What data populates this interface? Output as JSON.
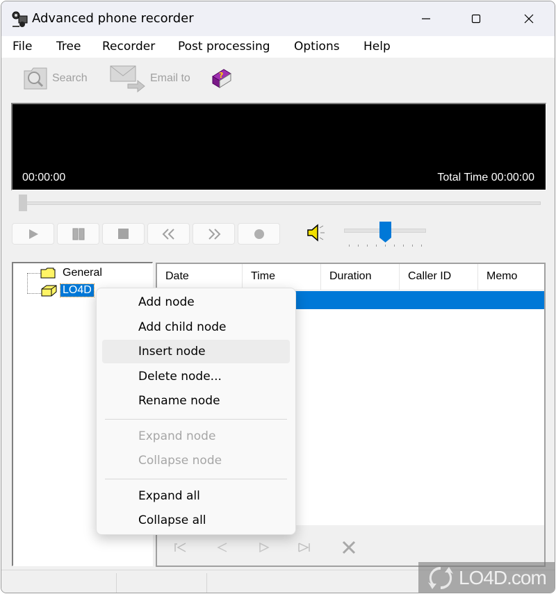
{
  "window": {
    "title": "Advanced phone recorder",
    "controls": {
      "minimize": "minimize",
      "maximize": "maximize",
      "close": "close"
    }
  },
  "menubar": {
    "items": [
      {
        "label": "File"
      },
      {
        "label": "Tree"
      },
      {
        "label": "Recorder"
      },
      {
        "label": "Post processing"
      },
      {
        "label": "Options"
      },
      {
        "label": "Help"
      }
    ]
  },
  "toolbar": {
    "search_label": "Search",
    "email_label": "Email to",
    "help_icon": "help-book-icon"
  },
  "display": {
    "current_time": "00:00:00",
    "total_time": "Total Time 00:00:00"
  },
  "player": {
    "seek_position": 0,
    "controls": [
      "play",
      "pause",
      "stop",
      "rewind",
      "fast-forward",
      "record"
    ],
    "volume_percent": 50,
    "volume_ticks": 9
  },
  "tree": {
    "nodes": [
      {
        "label": "General",
        "icon": "folder-closed-icon",
        "selected": false
      },
      {
        "label": "LO4D",
        "icon": "folder-open-icon",
        "selected": true
      }
    ]
  },
  "list": {
    "columns": [
      "Date",
      "Time",
      "Duration",
      "Caller ID",
      "Memo"
    ],
    "selected_row": 0,
    "nav_buttons": [
      "first",
      "previous",
      "next",
      "last",
      "delete"
    ]
  },
  "context_menu": {
    "items": [
      {
        "label": "Add node",
        "disabled": false
      },
      {
        "label": "Add child node",
        "disabled": false
      },
      {
        "label": "Insert node",
        "disabled": false,
        "hovered": true
      },
      {
        "label": "Delete node...",
        "disabled": false
      },
      {
        "label": "Rename node",
        "disabled": false
      },
      {
        "label": "Expand node",
        "disabled": true
      },
      {
        "label": "Collapse node",
        "disabled": true
      },
      {
        "label": "Expand all",
        "disabled": false
      },
      {
        "label": "Collapse all",
        "disabled": false
      }
    ]
  },
  "watermark": {
    "text": "LO4D.com"
  },
  "colors": {
    "selection": "#0078d7",
    "disabled_text": "#a6a6a6",
    "display_bg": "#000000"
  }
}
